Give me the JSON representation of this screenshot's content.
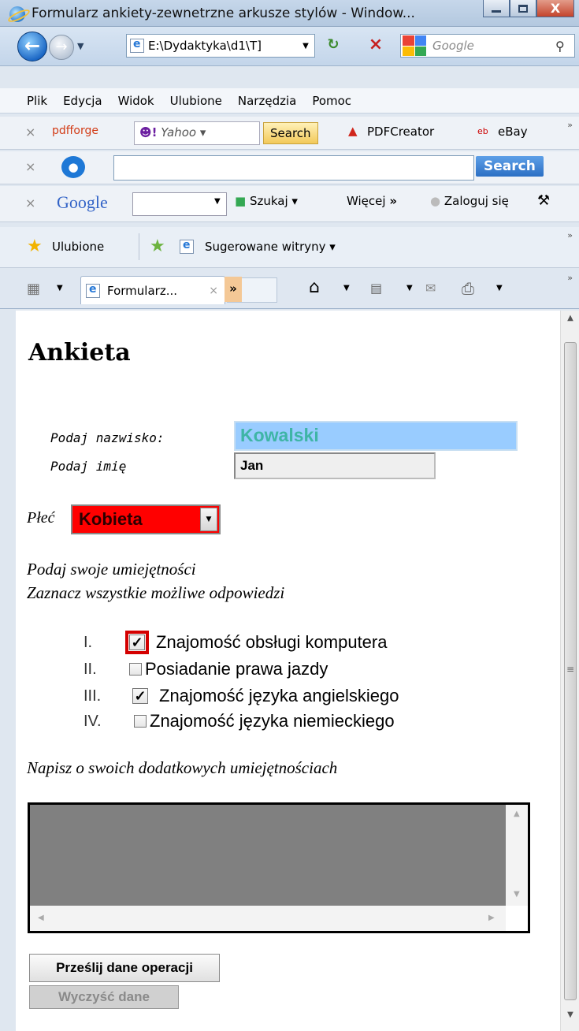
{
  "window": {
    "title": "Formularz ankiety-zewnetrzne arkusze stylów - Window...",
    "close_glyph": "X"
  },
  "nav": {
    "address": "E:\\Dydaktyka\\d1\\T]",
    "search_placeholder": "Google"
  },
  "menu": [
    "Plik",
    "Edycja",
    "Widok",
    "Ulubione",
    "Narzędzia",
    "Pomoc"
  ],
  "toolbar1": {
    "pdfforge": "pdfforge",
    "yahoo": "Yahoo",
    "search_btn": "Search",
    "pdfcreator": "PDFCreator",
    "ebay": "eBay"
  },
  "toolbar2": {
    "search_btn": "Search"
  },
  "toolbar3": {
    "google": "Google",
    "szukaj": "Szukaj",
    "wiecej": "Więcej",
    "zaloguj": "Zaloguj się"
  },
  "favorites": {
    "ulubione": "Ulubione",
    "sugerowane": "Sugerowane witryny"
  },
  "tabs": {
    "active": "Formularz..."
  },
  "form": {
    "heading": "Ankieta",
    "surname_label": "Podaj nazwisko:",
    "surname_value": "Kowalski",
    "name_label": "Podaj imię",
    "name_value": "Jan",
    "gender_label": "Płeć",
    "gender_value": "Kobieta",
    "skills_intro_1": "Podaj swoje umiejętności",
    "skills_intro_2": "Zaznacz wszystkie możliwe odpowiedzi",
    "skills": [
      {
        "num": "I.",
        "label": "Znajomość obsługi komputera",
        "checked": true
      },
      {
        "num": "II.",
        "label": "Posiadanie prawa jazdy",
        "checked": false
      },
      {
        "num": "III.",
        "label": "Znajomość języka angielskiego",
        "checked": true
      },
      {
        "num": "IV.",
        "label": "Znajomość języka niemieckiego",
        "checked": false
      }
    ],
    "extra_label": "Napisz o swoich dodatkowych umiejętnościach",
    "submit": "Prześlij dane operacji",
    "reset": "Wyczyść dane"
  }
}
